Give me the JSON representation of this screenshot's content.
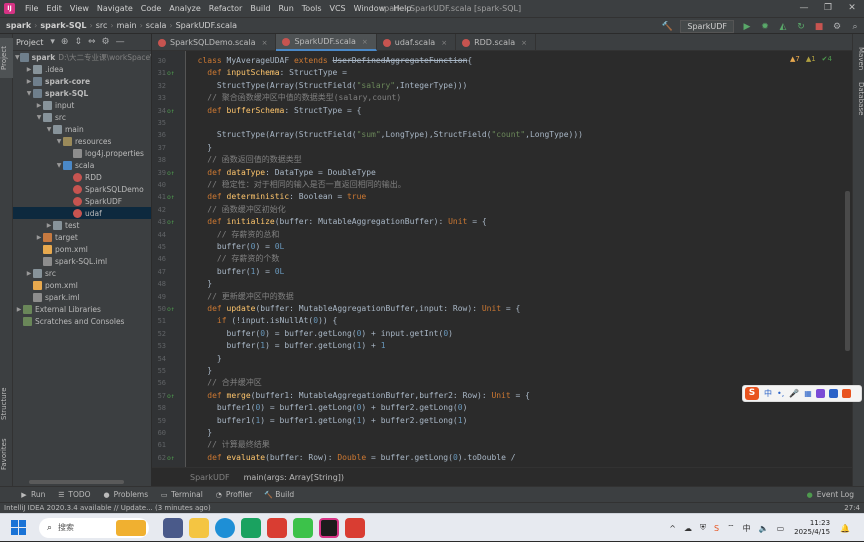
{
  "menubar": {
    "items": [
      "File",
      "Edit",
      "View",
      "Navigate",
      "Code",
      "Analyze",
      "Refactor",
      "Build",
      "Run",
      "Tools",
      "VCS",
      "Window",
      "Help"
    ],
    "title": "spark - SparkUDF.scala [spark-SQL]"
  },
  "navbar": {
    "crumbs": [
      "spark",
      "spark-SQL",
      "src",
      "main",
      "scala",
      "SparkUDF.scala"
    ],
    "run_config": "SparkUDF"
  },
  "sidebar_left": {
    "project_tab": "Project",
    "structure_tab": "Structure",
    "favorites_tab": "Favorites"
  },
  "sidebar_right": {
    "maven_tab": "Maven",
    "database_tab": "Database"
  },
  "project": {
    "header": "Project",
    "tree": [
      {
        "label": "spark",
        "hint": "D:\\大二专业课\\workSpace\\wo",
        "indent": 0,
        "arrow": "▼",
        "icon": "folder mod",
        "bold": true
      },
      {
        "label": ".idea",
        "indent": 1,
        "arrow": "▶",
        "icon": "folder"
      },
      {
        "label": "spark-core",
        "indent": 1,
        "arrow": "▶",
        "icon": "folder mod",
        "bold": true
      },
      {
        "label": "spark-SQL",
        "indent": 1,
        "arrow": "▼",
        "icon": "folder mod",
        "bold": true
      },
      {
        "label": "input",
        "indent": 2,
        "arrow": "▶",
        "icon": "folder"
      },
      {
        "label": "src",
        "indent": 2,
        "arrow": "▼",
        "icon": "folder"
      },
      {
        "label": "main",
        "indent": 3,
        "arrow": "▼",
        "icon": "folder"
      },
      {
        "label": "resources",
        "indent": 4,
        "arrow": "▼",
        "icon": "folder res"
      },
      {
        "label": "log4j.properties",
        "indent": 5,
        "arrow": "",
        "icon": "pfile"
      },
      {
        "label": "scala",
        "indent": 4,
        "arrow": "▼",
        "icon": "folder src"
      },
      {
        "label": "RDD",
        "indent": 5,
        "arrow": "",
        "icon": "sfile"
      },
      {
        "label": "SparkSQLDemo",
        "indent": 5,
        "arrow": "",
        "icon": "sfile"
      },
      {
        "label": "SparkUDF",
        "indent": 5,
        "arrow": "",
        "icon": "sfile"
      },
      {
        "label": "udaf",
        "indent": 5,
        "arrow": "",
        "icon": "sfile",
        "selected": true
      },
      {
        "label": "test",
        "indent": 3,
        "arrow": "▶",
        "icon": "folder"
      },
      {
        "label": "target",
        "indent": 2,
        "arrow": "▶",
        "icon": "folder ex"
      },
      {
        "label": "pom.xml",
        "indent": 2,
        "arrow": "",
        "icon": "xfile"
      },
      {
        "label": "spark-SQL.iml",
        "indent": 2,
        "arrow": "",
        "icon": "pfile"
      },
      {
        "label": "src",
        "indent": 1,
        "arrow": "▶",
        "icon": "folder"
      },
      {
        "label": "pom.xml",
        "indent": 1,
        "arrow": "",
        "icon": "xfile"
      },
      {
        "label": "spark.iml",
        "indent": 1,
        "arrow": "",
        "icon": "pfile"
      },
      {
        "label": "External Libraries",
        "indent": 0,
        "arrow": "▶",
        "icon": "lib"
      },
      {
        "label": "Scratches and Consoles",
        "indent": 0,
        "arrow": "",
        "icon": "lib"
      }
    ]
  },
  "tabs": [
    {
      "label": "SparkSQLDemo.scala",
      "active": false
    },
    {
      "label": "SparkUDF.scala",
      "active": true
    },
    {
      "label": "udaf.scala",
      "active": false
    },
    {
      "label": "RDD.scala",
      "active": false
    }
  ],
  "tab_close_glyph": "×",
  "inspection": {
    "warnings": "▲7",
    "weak": "▲1",
    "ok": "✔4"
  },
  "editor": {
    "lines": [
      {
        "n": "30",
        "mark": "",
        "html": "  <span class='kw'>class</span> MyAverageUDAF <span class='kw'>extends</span> <span class='strike'>UserDefinedAggregateFunction</span>{"
      },
      {
        "n": "31",
        "mark": "o↑",
        "html": "    <span class='kw'>def</span> <span class='fn'>inputSchema</span>: StructType ="
      },
      {
        "n": "32",
        "mark": "",
        "html": "      StructType(Array(StructField(<span class='st'>\"salary\"</span>,IntegerType)))"
      },
      {
        "n": "33",
        "mark": "",
        "html": "    <span class='cm'>// 聚合函数缓冲区中值的数据类型(salary,count)</span>"
      },
      {
        "n": "34",
        "mark": "o↑",
        "html": "    <span class='kw'>def</span> <span class='fn'>bufferSchema</span>: StructType = {"
      },
      {
        "n": "35",
        "mark": "",
        "html": ""
      },
      {
        "n": "36",
        "mark": "",
        "html": "      StructType(Array(StructField(<span class='st'>\"sum\"</span>,LongType),StructField(<span class='st'>\"count\"</span>,LongType)))"
      },
      {
        "n": "37",
        "mark": "",
        "html": "    }"
      },
      {
        "n": "38",
        "mark": "",
        "html": "    <span class='cm'>// 函数返回值的数据类型</span>"
      },
      {
        "n": "39",
        "mark": "o↑",
        "html": "    <span class='kw'>def</span> <span class='fn'>dataType</span>: DataType = DoubleType"
      },
      {
        "n": "40",
        "mark": "",
        "html": "    <span class='cm'>// 稳定性：对于相同的输入是否一直返回相同的输出。</span>"
      },
      {
        "n": "41",
        "mark": "o↑",
        "html": "    <span class='kw'>def</span> <span class='fn'>deterministic</span>: Boolean = <span class='kw'>true</span>"
      },
      {
        "n": "42",
        "mark": "",
        "html": "    <span class='cm'>// 函数缓冲区初始化</span>"
      },
      {
        "n": "43",
        "mark": "o↑",
        "html": "    <span class='kw'>def</span> <span class='fn'>initialize</span>(buffer: MutableAggregationBuffer): <span class='kw'>Unit</span> = {"
      },
      {
        "n": "44",
        "mark": "",
        "html": "      <span class='cm'>// 存薪资的总和</span>"
      },
      {
        "n": "45",
        "mark": "",
        "html": "      buffer(<span class='nu'>0</span>) = <span class='nu'>0L</span>"
      },
      {
        "n": "46",
        "mark": "",
        "html": "      <span class='cm'>// 存薪资的个数</span>"
      },
      {
        "n": "47",
        "mark": "",
        "html": "      buffer(<span class='nu'>1</span>) = <span class='nu'>0L</span>"
      },
      {
        "n": "48",
        "mark": "",
        "html": "    }"
      },
      {
        "n": "49",
        "mark": "",
        "html": "    <span class='cm'>// 更新缓冲区中的数据</span>"
      },
      {
        "n": "50",
        "mark": "o↑",
        "html": "    <span class='kw'>def</span> <span class='fn'>update</span>(buffer: MutableAggregationBuffer,input: Row): <span class='kw'>Unit</span> = {"
      },
      {
        "n": "51",
        "mark": "",
        "html": "      <span class='kw'>if</span> (!input.isNullAt(<span class='nu'>0</span>)) {"
      },
      {
        "n": "52",
        "mark": "",
        "html": "        buffer(<span class='nu'>0</span>) = buffer.getLong(<span class='nu'>0</span>) + input.getInt(<span class='nu'>0</span>)"
      },
      {
        "n": "53",
        "mark": "",
        "html": "        buffer(<span class='nu'>1</span>) = buffer.getLong(<span class='nu'>1</span>) + <span class='nu'>1</span>"
      },
      {
        "n": "54",
        "mark": "",
        "html": "      }"
      },
      {
        "n": "55",
        "mark": "",
        "html": "    }"
      },
      {
        "n": "56",
        "mark": "",
        "html": "    <span class='cm'>// 合并缓冲区</span>"
      },
      {
        "n": "57",
        "mark": "o↑",
        "html": "    <span class='kw'>def</span> <span class='fn'>merge</span>(buffer1: MutableAggregationBuffer,buffer2: Row): <span class='kw'>Unit</span> = {"
      },
      {
        "n": "58",
        "mark": "",
        "html": "      buffer1(<span class='nu'>0</span>) = buffer1.getLong(<span class='nu'>0</span>) + buffer2.getLong(<span class='nu'>0</span>)"
      },
      {
        "n": "59",
        "mark": "",
        "html": "      buffer1(<span class='nu'>1</span>) = buffer1.getLong(<span class='nu'>1</span>) + buffer2.getLong(<span class='nu'>1</span>)"
      },
      {
        "n": "60",
        "mark": "",
        "html": "    }"
      },
      {
        "n": "61",
        "mark": "",
        "html": "    <span class='cm'>// 计算最终结果</span>"
      },
      {
        "n": "62",
        "mark": "o↑",
        "html": "    <span class='kw'>def</span> <span class='fn'>evaluate</span>(buffer: Row): <span class='kw'>Double</span> = buffer.getLong(<span class='nu'>0</span>).toDouble /"
      }
    ]
  },
  "editor_breadcrumb": {
    "left": "SparkUDF",
    "right": "main(args: Array[String])"
  },
  "bottom_tools": [
    "Run",
    "TODO",
    "Problems",
    "Terminal",
    "Profiler",
    "Build"
  ],
  "event_log": "Event Log",
  "status": {
    "message": "IntelliJ IDEA 2020.3.4 available // Update... (3 minutes ago)",
    "position": "27:4"
  },
  "ime": {
    "logo": "S",
    "chars": [
      "中",
      "•,",
      "🎤",
      "▦"
    ]
  },
  "taskbar": {
    "search_placeholder": "搜索",
    "time": "11:23",
    "date": "2025/4/15",
    "tray_up": "^",
    "tray_lang": "中"
  }
}
